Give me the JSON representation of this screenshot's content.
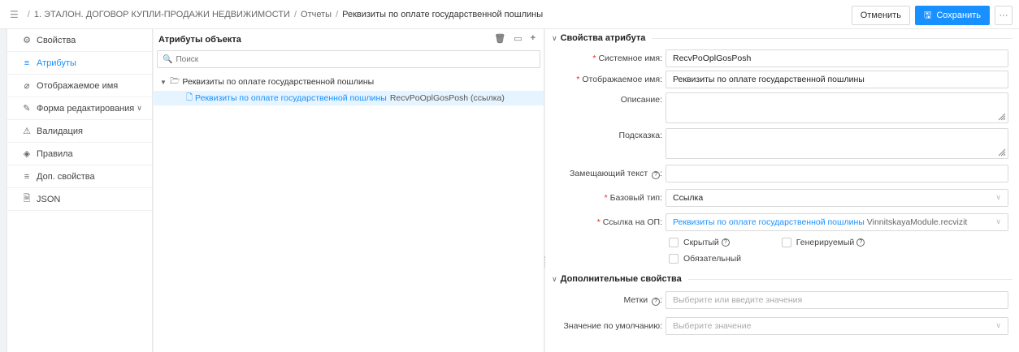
{
  "breadcrumb": {
    "items": [
      "1. ЭТАЛОН. ДОГОВОР КУПЛИ-ПРОДАЖИ НЕДВИЖИМОСТИ",
      "Отчеты"
    ],
    "current": "Реквизиты по оплате государственной пошлины"
  },
  "actions": {
    "cancel": "Отменить",
    "save": "Сохранить",
    "more": "···"
  },
  "leftnav": {
    "items": [
      {
        "label": "Свойства",
        "icon": "gear-icon"
      },
      {
        "label": "Атрибуты",
        "icon": "list-icon"
      },
      {
        "label": "Отображаемое имя",
        "icon": "tag-icon"
      },
      {
        "label": "Форма редактирования",
        "icon": "edit-icon"
      },
      {
        "label": "Валидация",
        "icon": "warning-icon"
      },
      {
        "label": "Правила",
        "icon": "rule-icon"
      },
      {
        "label": "Доп. свойства",
        "icon": "list-icon"
      },
      {
        "label": "JSON",
        "icon": "file-icon"
      }
    ]
  },
  "attributes": {
    "title": "Атрибуты объекта",
    "search_placeholder": "Поиск",
    "root": "Реквизиты по оплате государственной пошлины",
    "child": {
      "name": "Реквизиты по оплате государственной пошлины",
      "system": "RecvPoOplGosPosh (ссылка)"
    }
  },
  "props": {
    "title": "Свойства атрибута",
    "system_name_label": "Системное имя:",
    "system_name_value": "RecvPoOplGosPosh",
    "display_name_label": "Отображаемое имя:",
    "display_name_value": "Реквизиты по оплате государственной пошлины",
    "description_label": "Описание:",
    "hint_label": "Подсказка:",
    "replacement_label": "Замещающий текст",
    "base_type_label": "Базовый тип:",
    "base_type_value": "Ссылка",
    "ref_label": "Ссылка на ОП:",
    "ref_value": "Реквизиты по оплате государственной пошлины",
    "ref_module": "VinnitskayaModule.recvizit",
    "hidden_label": "Скрытый",
    "generated_label": "Генерируемый",
    "required_label": "Обязательный"
  },
  "extra": {
    "title": "Дополнительные свойства",
    "tags_label": "Метки",
    "tags_placeholder": "Выберите или введите значения",
    "default_label": "Значение по умолчанию:",
    "default_placeholder": "Выберите значение"
  },
  "colors": {
    "accent": "#1890ff",
    "required": "#f5222d",
    "selected_bg": "#e6f4ff"
  }
}
